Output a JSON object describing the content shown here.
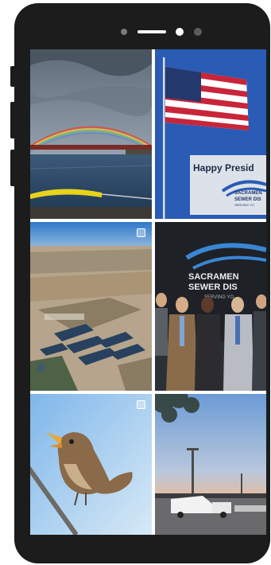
{
  "feed": {
    "posts": [
      {
        "description": ""
      },
      {
        "sign_headline": "Happy Presid",
        "sign_org_line1": "SACRAMEN",
        "sign_org_line2": "SEWER DIS",
        "sign_tagline": "SERVING YO"
      },
      {
        "description": ""
      },
      {
        "wall_org_line1": "SACRAMEN",
        "wall_org_line2": "SEWER DIS",
        "wall_tagline": "SERVING YO"
      },
      {
        "description": ""
      },
      {
        "description": ""
      }
    ]
  },
  "colors": {
    "phone_body": "#1c1c1c",
    "screen_background": "#ffffff",
    "sign_blue": "#2a5bb5"
  },
  "icons": [
    "multiple-photos-icon"
  ]
}
